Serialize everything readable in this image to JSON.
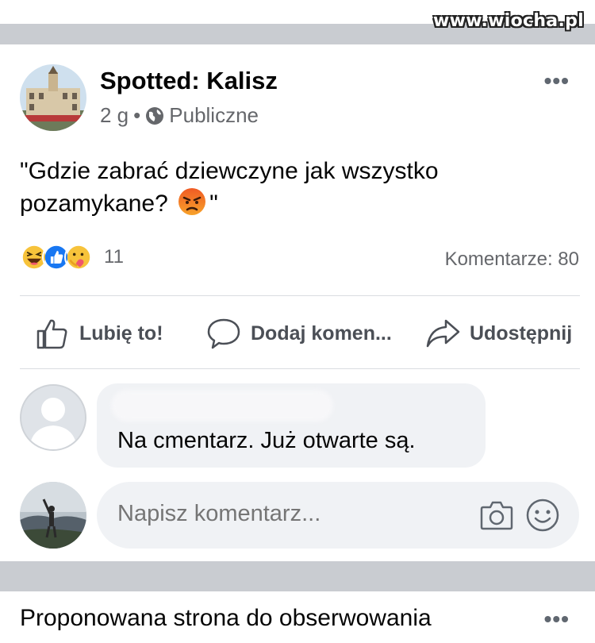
{
  "watermark": "www.wiocha.pl",
  "post": {
    "page_name": "Spotted: Kalisz",
    "time": "2 g",
    "separator": "•",
    "audience": "Publiczne",
    "more": "•••",
    "text_line1": "\"Gdzie zabrać dziewczyne jak wszystko",
    "text_line2": "pozamykane?",
    "text_end": "\"",
    "reaction_icons": [
      "laugh-emoji",
      "like-emoji",
      "care-emoji"
    ],
    "reaction_count": "11",
    "comments_count": "Komentarze: 80"
  },
  "actions": {
    "like": "Lubię to!",
    "comment": "Dodaj komen...",
    "share": "Udostępnij"
  },
  "comment": {
    "text": "Na cmentarz. Już otwarte są."
  },
  "write": {
    "placeholder": "Napisz komentarz..."
  },
  "suggestion": {
    "title": "Proponowana strona do obserwowania",
    "more": "•••"
  },
  "colors": {
    "separator_band": "#c9ccd1",
    "bubble": "#f0f2f5",
    "secondary_text": "#65676b",
    "like_blue": "#1877f2"
  }
}
